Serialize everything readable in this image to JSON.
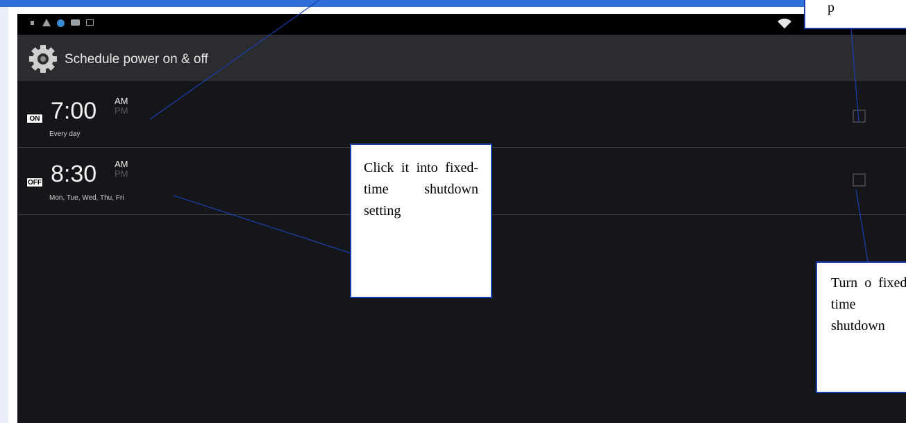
{
  "status_bar": {
    "icons": [
      "lock-icon",
      "warning-icon",
      "globe-icon",
      "chat-icon",
      "photo-icon",
      "wifi-icon"
    ]
  },
  "action_bar": {
    "icon": "gear-icon",
    "title": "Schedule power on & off"
  },
  "schedules": [
    {
      "badge": "ON",
      "time": "7:00",
      "am": "AM",
      "pm": "PM",
      "repeat": "Every day",
      "checked": false
    },
    {
      "badge": "OFF",
      "time": "8:30",
      "am": "AM",
      "pm": "PM",
      "repeat": "Mon, Tue, Wed, Thu, Fri",
      "checked": false
    }
  ],
  "callouts": {
    "shutdown_setting": "Click it into fixed-time shutdown setting",
    "turn_on_shutdown": "Turn o fixed-time shutdown",
    "top_right_fragment": "p"
  },
  "colors": {
    "accent_strip": "#2e6fd8",
    "screen_bg": "#151619",
    "action_bar_bg": "#2b2c2f",
    "callout_border": "#1b3fb0"
  }
}
